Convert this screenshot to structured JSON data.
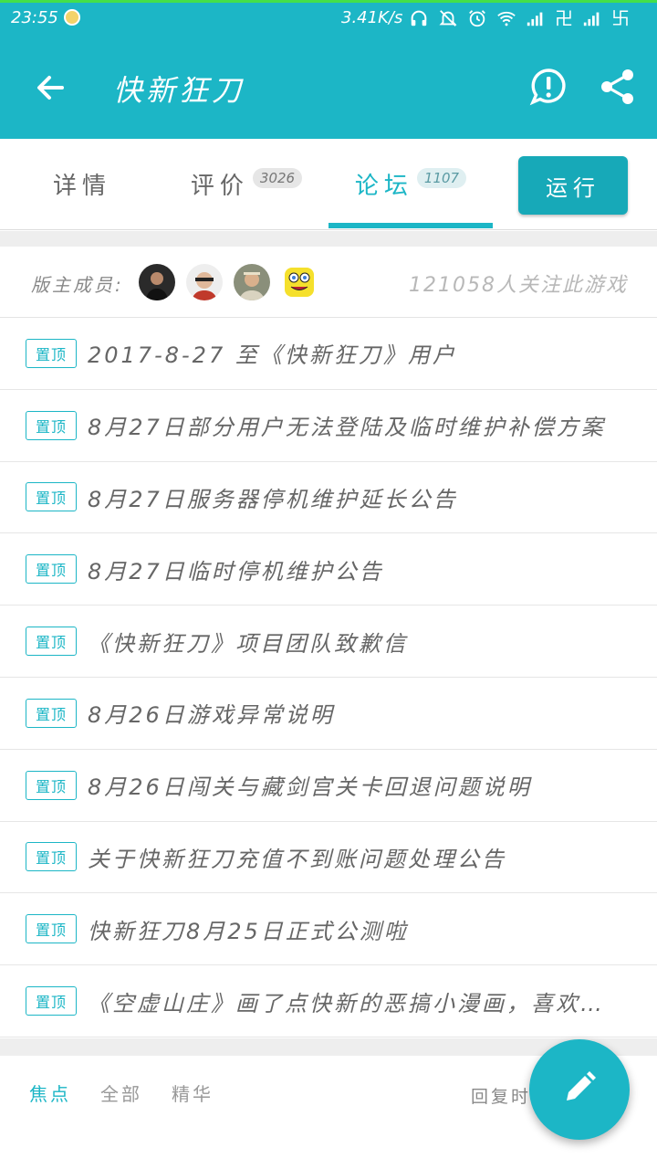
{
  "status_bar": {
    "time": "23:55",
    "net_speed": "3.41K/s",
    "sim_glyph_1": "卍",
    "sim_glyph_2": "卐"
  },
  "app_bar": {
    "title": "快新狂刀",
    "icons": [
      "back-arrow-icon",
      "report-icon",
      "share-icon"
    ]
  },
  "tabs": [
    {
      "label": "详情",
      "count": ""
    },
    {
      "label": "评价",
      "count": "3026"
    },
    {
      "label": "论坛",
      "count": "1107",
      "active": true
    }
  ],
  "run_button": "运行",
  "moderators": {
    "label": "版主成员:",
    "followers": "121058人关注此游戏"
  },
  "pin_label": "置顶",
  "pinned_posts": [
    "2017-8-27 至《快新狂刀》用户",
    "8月27日部分用户无法登陆及临时维护补偿方案",
    "8月27日服务器停机维护延长公告",
    "8月27日临时停机维护公告",
    "《快新狂刀》项目团队致歉信",
    "8月26日游戏异常说明",
    "8月26日闯关与藏剑宫关卡回退问题说明",
    "关于快新狂刀充值不到账问题处理公告",
    "快新狂刀8月25日正式公测啦",
    "《空虚山庄》画了点快新的恶搞小漫画，喜欢的可以看看"
  ],
  "filters": [
    "焦点",
    "全部",
    "精华"
  ],
  "sort_label": "回复时间",
  "colors": {
    "accent": "#1cb6c6",
    "accent_dark": "#17a9b8"
  }
}
